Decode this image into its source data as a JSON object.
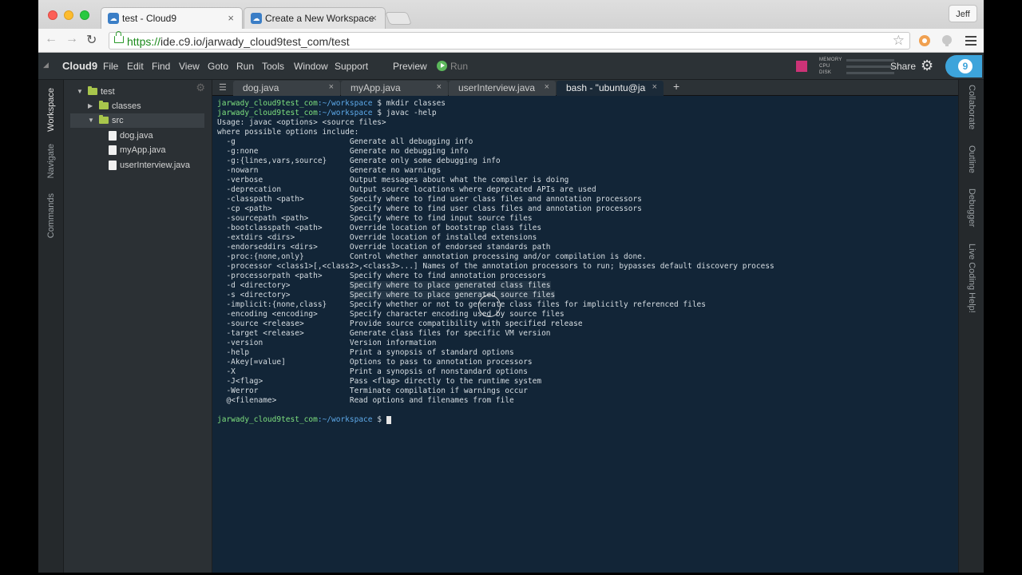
{
  "browser": {
    "tabs": [
      {
        "title": "test - Cloud9",
        "active": true
      },
      {
        "title": "Create a New Workspace",
        "active": false
      }
    ],
    "user": "Jeff",
    "url_scheme": "https://",
    "url_rest": "ide.c9.io/jarwady_cloud9test_com/test",
    "close_glyph": "×"
  },
  "ide": {
    "brand": "Cloud9",
    "menu": [
      "File",
      "Edit",
      "Find",
      "View",
      "Goto",
      "Run",
      "Tools",
      "Window",
      "Support"
    ],
    "preview": "Preview",
    "run": "Run",
    "meters": [
      "MEMORY",
      "CPU",
      "DISK"
    ],
    "share": "Share",
    "left_panels": [
      "Workspace",
      "Navigate",
      "Commands"
    ],
    "right_panels": [
      "Collaborate",
      "Outline",
      "Debugger",
      "Live Coding Help!"
    ],
    "tree": {
      "root": "test",
      "folders": [
        "classes",
        "src"
      ],
      "files": [
        "dog.java",
        "myApp.java",
        "userInterview.java"
      ]
    },
    "editor_tabs": [
      "dog.java",
      "myApp.java",
      "userInterview.java",
      "bash - \"ubuntu@jarw"
    ],
    "terminal": {
      "prompt_user": "jarwady_cloud9test_com",
      "prompt_path": ":~/workspace",
      "prompt_sign": " $ ",
      "cmd1": "mkdir classes",
      "cmd2": "javac -help",
      "usage": "Usage: javac <options> <source files>",
      "where": "where possible options include:",
      "options": [
        {
          "opt": "-g",
          "desc": "Generate all debugging info"
        },
        {
          "opt": "-g:none",
          "desc": "Generate no debugging info"
        },
        {
          "opt": "-g:{lines,vars,source}",
          "desc": "Generate only some debugging info"
        },
        {
          "opt": "-nowarn",
          "desc": "Generate no warnings"
        },
        {
          "opt": "-verbose",
          "desc": "Output messages about what the compiler is doing"
        },
        {
          "opt": "-deprecation",
          "desc": "Output source locations where deprecated APIs are used"
        },
        {
          "opt": "-classpath <path>",
          "desc": "Specify where to find user class files and annotation processors"
        },
        {
          "opt": "-cp <path>",
          "desc": "Specify where to find user class files and annotation processors"
        },
        {
          "opt": "-sourcepath <path>",
          "desc": "Specify where to find input source files"
        },
        {
          "opt": "-bootclasspath <path>",
          "desc": "Override location of bootstrap class files"
        },
        {
          "opt": "-extdirs <dirs>",
          "desc": "Override location of installed extensions"
        },
        {
          "opt": "-endorseddirs <dirs>",
          "desc": "Override location of endorsed standards path"
        },
        {
          "opt": "-proc:{none,only}",
          "desc": "Control whether annotation processing and/or compilation is done."
        },
        {
          "opt": "-processor <class1>[,<class2>,<class3>...]",
          "desc": "Names of the annotation processors to run; bypasses default discovery process"
        },
        {
          "opt": "-processorpath <path>",
          "desc": "Specify where to find annotation processors"
        },
        {
          "opt": "-d <directory>",
          "desc": "Specify where to place generated class files"
        },
        {
          "opt": "-s <directory>",
          "desc": "Specify where to place generated source files"
        },
        {
          "opt": "-implicit:{none,class}",
          "desc": "Specify whether or not to generate class files for implicitly referenced files"
        },
        {
          "opt": "-encoding <encoding>",
          "desc": "Specify character encoding used by source files"
        },
        {
          "opt": "-source <release>",
          "desc": "Provide source compatibility with specified release"
        },
        {
          "opt": "-target <release>",
          "desc": "Generate class files for specific VM version"
        },
        {
          "opt": "-version",
          "desc": "Version information"
        },
        {
          "opt": "-help",
          "desc": "Print a synopsis of standard options"
        },
        {
          "opt": "-Akey[=value]",
          "desc": "Options to pass to annotation processors"
        },
        {
          "opt": "-X",
          "desc": "Print a synopsis of nonstandard options"
        },
        {
          "opt": "-J<flag>",
          "desc": "Pass <flag> directly to the runtime system"
        },
        {
          "opt": "-Werror",
          "desc": "Terminate compilation if warnings occur"
        },
        {
          "opt": "@<filename>",
          "desc": "Read options and filenames from file"
        }
      ]
    }
  }
}
